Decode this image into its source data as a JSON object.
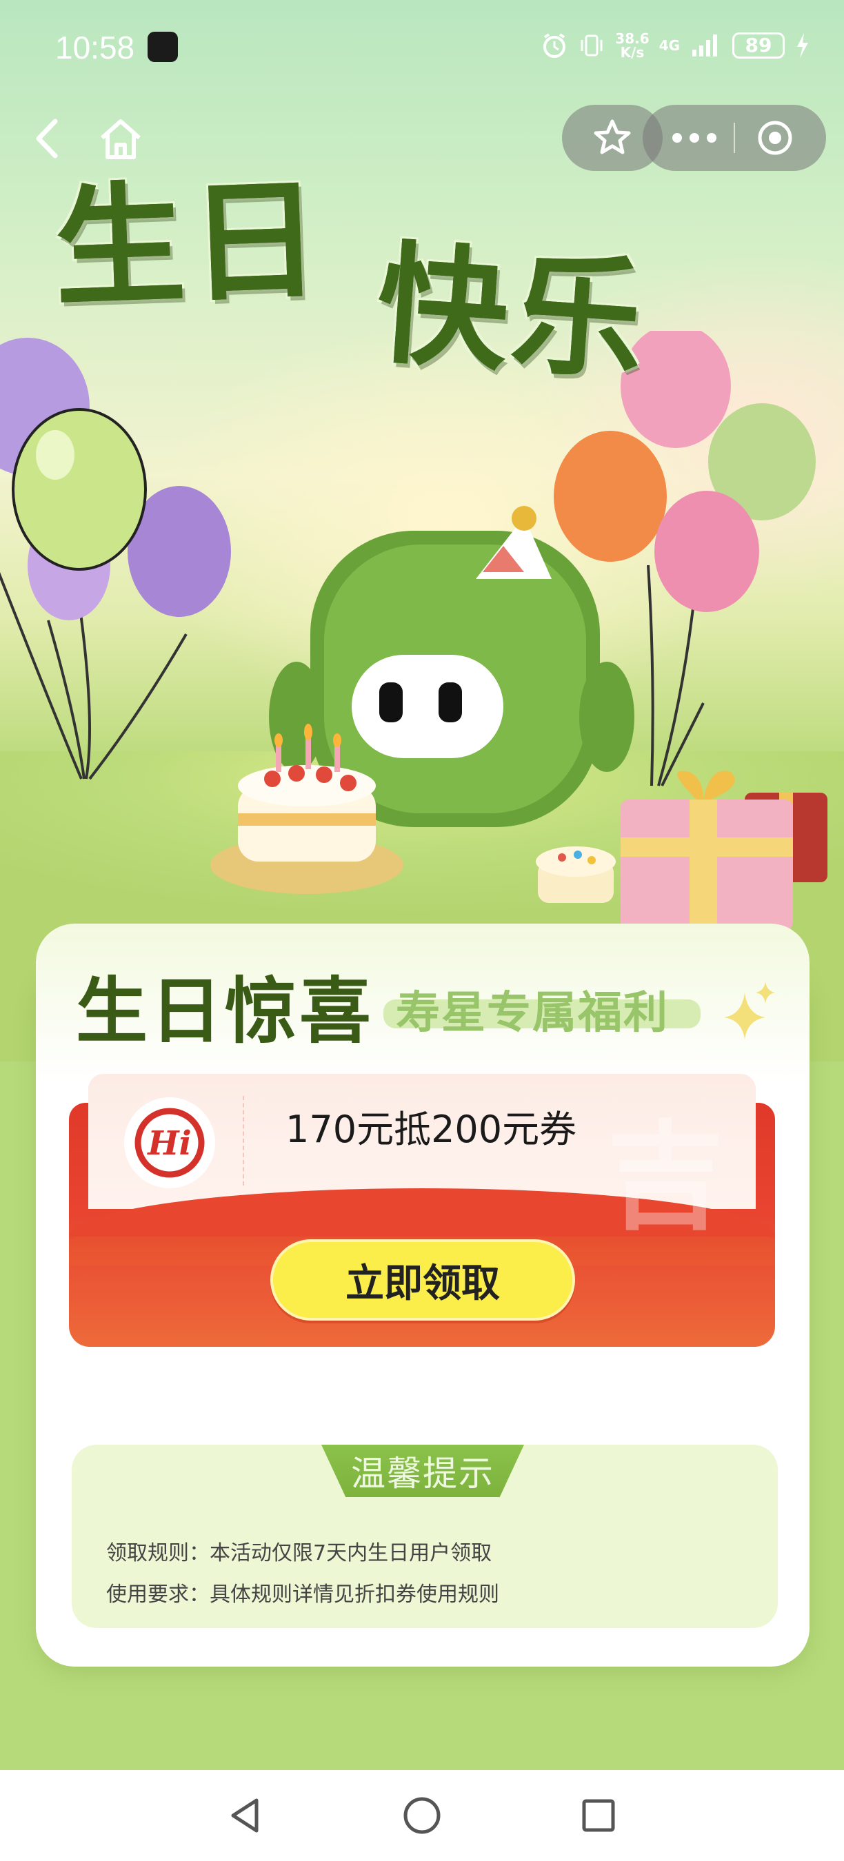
{
  "status_bar": {
    "time": "10:58",
    "net_speed_value": "38.6",
    "net_speed_unit": "K/s",
    "network": "4G",
    "battery": "89"
  },
  "header": {
    "headline_line1": "生日",
    "headline_line2": "快乐"
  },
  "card": {
    "title": "生日惊喜",
    "subtitle": "寿星专属福利"
  },
  "coupon": {
    "brand_logo_text": "Hi",
    "description": "170元抵200元券",
    "claim_label": "立即领取"
  },
  "tips": {
    "title": "温馨提示",
    "lines": [
      "领取规则：本活动仅限7天内生日用户领取",
      "使用要求：具体规则详情见折扣券使用规则"
    ]
  },
  "colors": {
    "accent_green": "#3f6a1a",
    "coupon_red": "#e0392a",
    "button_yellow": "#fbed4a",
    "tips_bg": "#edf7d3"
  },
  "icons": {
    "back": "chevron-left-icon",
    "home": "home-icon",
    "favorite": "star-icon",
    "more": "more-dots-icon",
    "close_miniapp": "target-circle-icon"
  }
}
